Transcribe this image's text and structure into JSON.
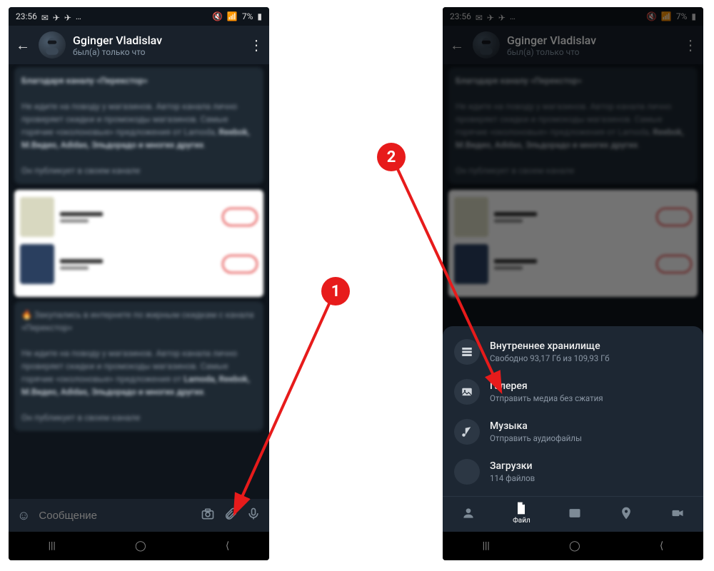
{
  "status": {
    "time": "23:56",
    "battery": "7%"
  },
  "chat": {
    "name": "Gginger Vladislav",
    "last_seen": "был(а) только что",
    "input_placeholder": "Сообщение"
  },
  "file_sheet": {
    "items": [
      {
        "icon": "storage-icon",
        "title": "Внутреннее хранилище",
        "sub": "Свободно 93,17 Гб из 109,93 Гб"
      },
      {
        "icon": "gallery-icon",
        "title": "Галерея",
        "sub": "Отправить медиа без сжатия"
      },
      {
        "icon": "music-icon",
        "title": "Музыка",
        "sub": "Отправить аудиофайлы"
      },
      {
        "icon": "downloads-icon",
        "title": "Загрузки",
        "sub": "114 файлов"
      }
    ],
    "tabs": {
      "file_label": "Файл"
    }
  },
  "annotations": {
    "a1": "1",
    "a2": "2"
  }
}
